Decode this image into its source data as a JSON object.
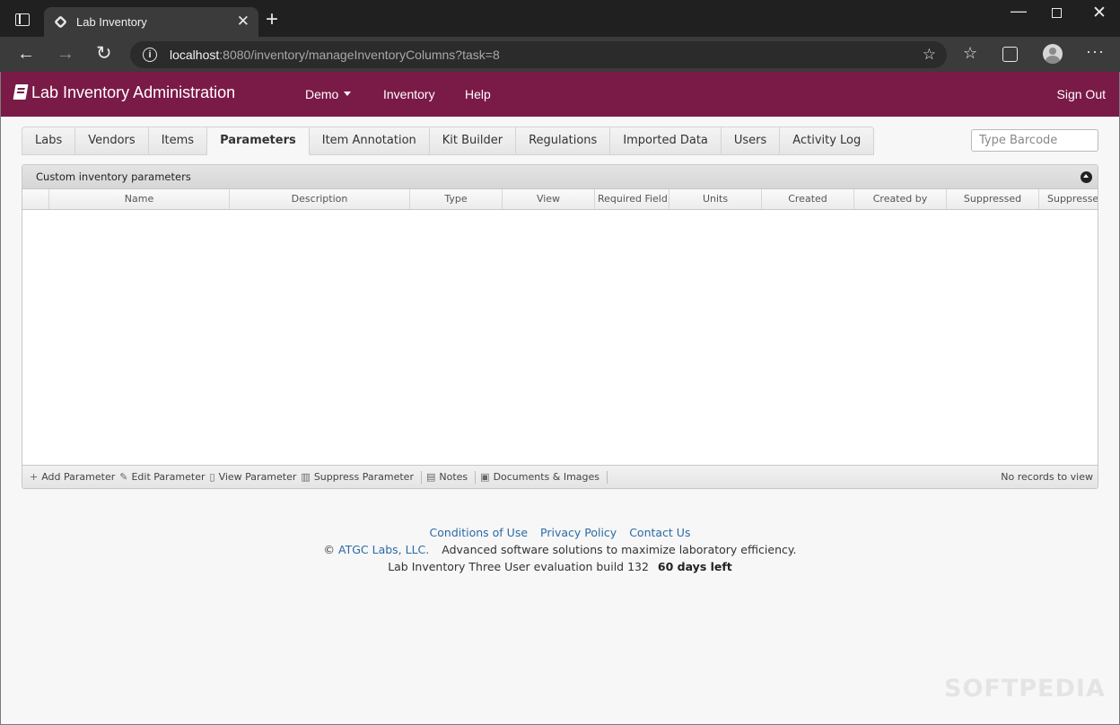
{
  "browser": {
    "tab_title": "Lab Inventory",
    "url_host": "localhost",
    "url_rest": ":8080/inventory/manageInventoryColumns?task=8"
  },
  "header": {
    "brand": "Lab Inventory Administration",
    "menu": {
      "demo": "Demo",
      "inventory": "Inventory",
      "help": "Help"
    },
    "sign_out": "Sign Out"
  },
  "tabs": [
    "Labs",
    "Vendors",
    "Items",
    "Parameters",
    "Item Annotation",
    "Kit Builder",
    "Regulations",
    "Imported Data",
    "Users",
    "Activity Log"
  ],
  "active_tab": "Parameters",
  "barcode": {
    "placeholder": "Type Barcode"
  },
  "grid": {
    "caption": "Custom inventory parameters",
    "columns": [
      "",
      "Name",
      "Description",
      "Type",
      "View",
      "Required Field",
      "Units",
      "Created",
      "Created by",
      "Suppressed",
      "Suppressed"
    ],
    "pager": {
      "add": "Add Parameter",
      "edit": "Edit Parameter",
      "view": "View Parameter",
      "suppress": "Suppress Parameter",
      "notes": "Notes",
      "documents": "Documents & Images",
      "info": "No records to view"
    }
  },
  "footer": {
    "conditions": "Conditions of Use",
    "privacy": "Privacy Policy",
    "contact": "Contact Us",
    "copyright_symbol": "©",
    "company": "ATGC Labs, LLC.",
    "tagline": "Advanced software solutions to maximize laboratory efficiency.",
    "build": "Lab Inventory Three User evaluation build 132",
    "days_left": "60 days left"
  },
  "watermark": "SOFTPEDIA",
  "colors": {
    "brand": "#7a1a47",
    "link": "#2b6aa8"
  }
}
